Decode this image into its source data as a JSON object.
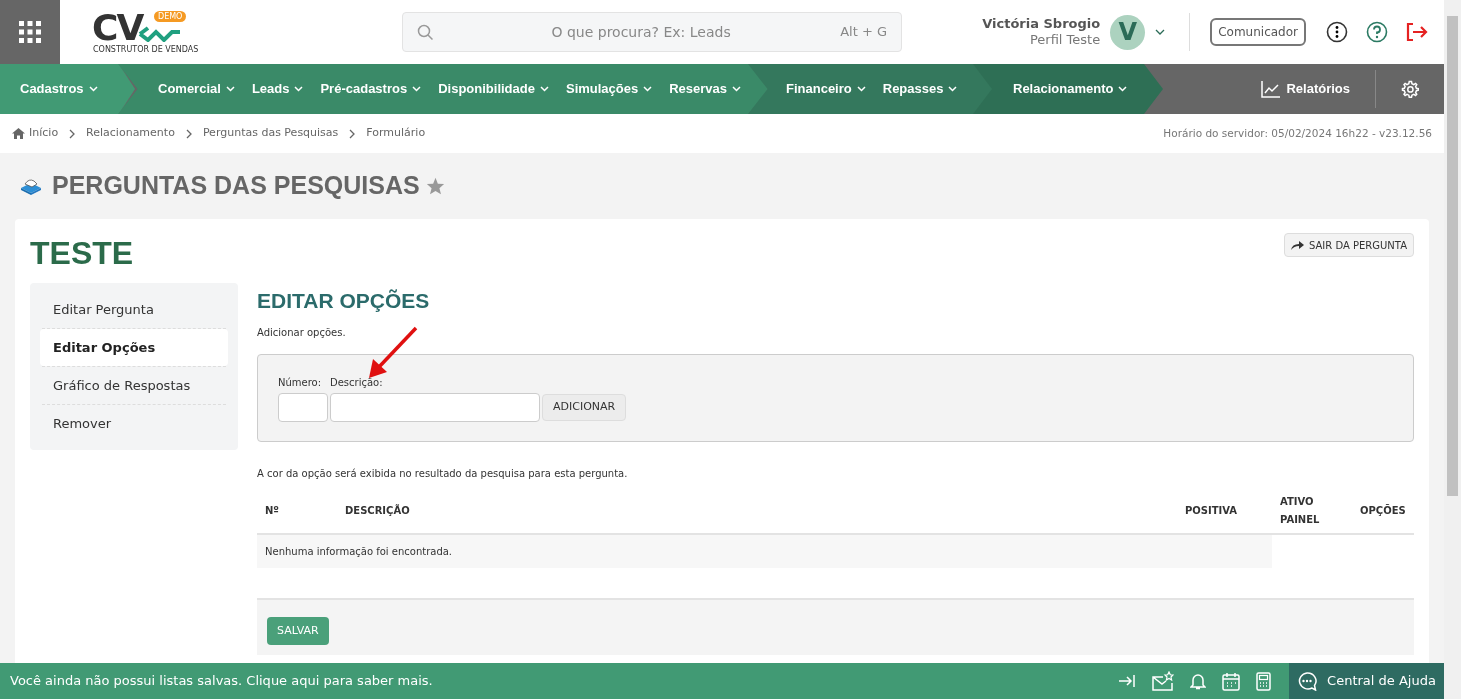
{
  "header": {
    "logo": {
      "letters": "CV",
      "badge": "DEMO",
      "tagline": "CONSTRUTOR DE VENDAS"
    },
    "search": {
      "placeholder": "O que procura? Ex: Leads",
      "shortcut": "Alt + G"
    },
    "user": {
      "name": "Victória Sbrogio",
      "profile": "Perfil Teste",
      "initial": "V"
    },
    "communicator": "Comunicador"
  },
  "nav": {
    "groups": [
      {
        "items": [
          "Cadastros"
        ]
      },
      {
        "items": [
          "Comercial",
          "Leads",
          "Pré-cadastros",
          "Disponibilidade",
          "Simulações",
          "Reservas"
        ]
      },
      {
        "items": [
          "Financeiro",
          "Repasses"
        ]
      },
      {
        "items": [
          "Relacionamento"
        ]
      }
    ],
    "reports": "Relatórios"
  },
  "breadcrumb": [
    "Início",
    "Relacionamento",
    "Perguntas das Pesquisas",
    "Formulário"
  ],
  "server_time": "Horário do servidor: 05/02/2024 16h22 - v23.12.56",
  "page_title": "PERGUNTAS DAS PESQUISAS",
  "record": {
    "title": "TESTE",
    "exit_button": "SAIR DA PERGUNTA"
  },
  "side_menu": [
    {
      "label": "Editar Pergunta",
      "selected": false
    },
    {
      "label": "Editar Opções",
      "selected": true
    },
    {
      "label": "Gráfico de Respostas",
      "selected": false
    },
    {
      "label": "Remover",
      "selected": false
    }
  ],
  "section": {
    "title": "EDITAR OPÇÕES",
    "hint": "Adicionar opções.",
    "number_label": "Número:",
    "description_label": "Descrição:",
    "add_button": "ADICIONAR",
    "note": "A cor da opção será exibida no resultado da pesquisa para esta pergunta."
  },
  "table": {
    "columns": [
      "Nº",
      "DESCRIÇÃO",
      "POSITIVA",
      "ATIVO PAINEL",
      "OPÇÕES"
    ],
    "empty_message": "Nenhuma informação foi encontrada."
  },
  "save_button": "SALVAR",
  "footer": {
    "message": "Você ainda não possui listas salvas. Clique aqui para saber mais.",
    "help": "Central de Ajuda"
  }
}
